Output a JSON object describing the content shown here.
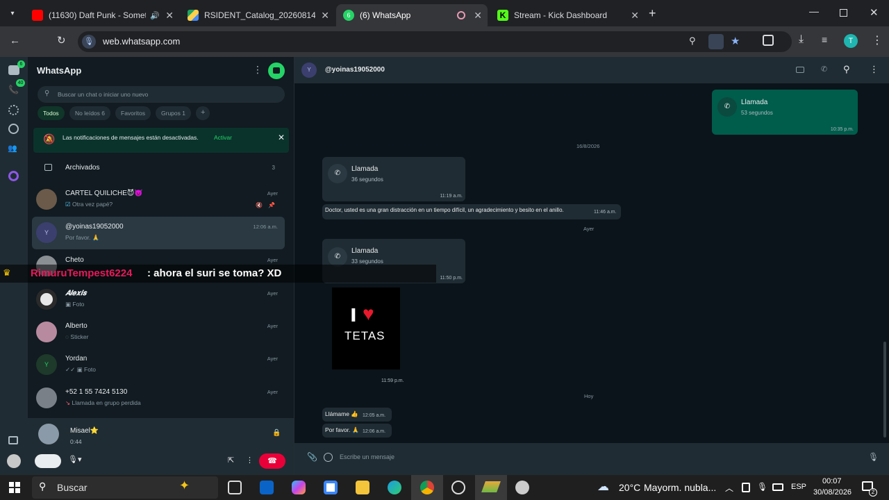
{
  "browser": {
    "tabs": [
      {
        "title": "(11630) Daft Punk - Someth",
        "active": false
      },
      {
        "title": "RSIDENT_Catalog_20260814.pd",
        "active": false
      },
      {
        "title": "(6) WhatsApp",
        "active": true
      },
      {
        "title": "Stream - Kick Dashboard",
        "active": false
      }
    ],
    "url": "web.whatsapp.com"
  },
  "rail": {
    "chats_badge": "6",
    "calls_badge": "40"
  },
  "sidebar": {
    "title": "WhatsApp",
    "search_placeholder": "Buscar un chat o iniciar uno nuevo",
    "filters": [
      "Todos",
      "No leídos 6",
      "Favoritos",
      "Grupos 1",
      "+"
    ],
    "notification_text": "Las notificaciones de mensajes están desactivadas.",
    "notification_action": "Activar",
    "archived_label": "Archivados",
    "archived_count": "3",
    "chats": [
      {
        "name": "CARTEL QUILICHE😈👿",
        "last": "Otra vez papé?",
        "time": "Ayer",
        "avatar": "#6b5a4a"
      },
      {
        "name": "@yoinas19052000",
        "last": "Por favor. 🙏",
        "time": "12:06 a.m.",
        "avatar": "#3b3f6e",
        "initial": "Y"
      },
      {
        "name": "Cheto",
        "last": "",
        "time": "Ayer",
        "avatar": "#8a8f94"
      },
      {
        "name": "𝑨𝒍𝒆𝒙𝒊𝒔",
        "last": "Foto",
        "time": "Ayer",
        "avatar": "#e8e8e8"
      },
      {
        "name": "Alberto",
        "last": "Sticker",
        "time": "Ayer",
        "avatar": "#b88aa0"
      },
      {
        "name": "Yordan",
        "last": "Foto",
        "time": "Ayer",
        "avatar": "#1e3a2a",
        "initial": "Y"
      },
      {
        "name": "+52 1 55 7424 5130",
        "last": "Llamada en grupo perdida",
        "time": "Ayer",
        "avatar": "#7a8088"
      }
    ],
    "call_bar": {
      "name": "Misael⭐",
      "duration": "0:44"
    }
  },
  "chat": {
    "contact": "@yoinas19052000",
    "contact_initial": "Y",
    "messages": {
      "call1_title": "Llamada",
      "call1_sub": "53 segundos",
      "call1_time": "10:35 p.m.",
      "date1": "16/8/2026",
      "call2_title": "Llamada",
      "call2_sub": "36 segundos",
      "call2_time": "11:19 a.m.",
      "text1": "Doctor, usted es una gran distracción en un tiempo difícil, un agradecimiento y besito en el anillo.",
      "text1_time": "11:46 a.m.",
      "date2": "Ayer",
      "call3_title": "Llamada",
      "call3_sub": "33 segundos",
      "call3_time": "11:50 p.m.",
      "image_text_top": "I",
      "image_text_bottom": "TETAS",
      "image_time": "11:59 p.m.",
      "date3": "Hoy",
      "text2": "Llámame 👍",
      "text2_time": "12:05 a.m.",
      "text3": "Por favor. 🙏",
      "text3_time": "12:06 a.m."
    },
    "composer_placeholder": "Escribe un mensaje"
  },
  "overlay": {
    "user": "RimuruTempest6224",
    "message": ": ahora el suri se toma? XD"
  },
  "taskbar": {
    "search": "Buscar",
    "weather_temp": "20°C",
    "weather_desc": "Mayorm. nubla...",
    "lang": "ESP",
    "time": "00:07",
    "date": "30/08/2026",
    "notif_count": "2"
  }
}
